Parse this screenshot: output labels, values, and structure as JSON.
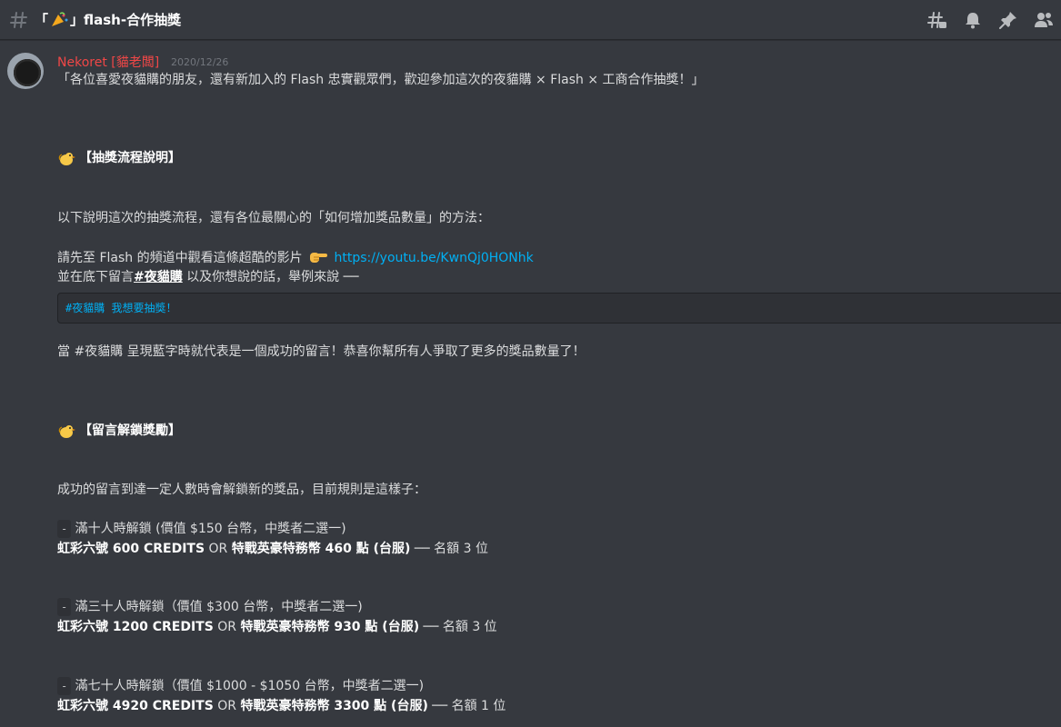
{
  "header": {
    "channel_prefix": "「",
    "channel_suffix": "」flash-合作抽獎",
    "icons": [
      "threads-icon",
      "bell-icon",
      "pin-icon",
      "members-icon"
    ]
  },
  "message": {
    "author": "Nekoret [貓老闆]",
    "timestamp": "2020/12/26",
    "intro": "「各位喜愛夜貓購的朋友，還有新加入的 Flash 忠實觀眾們，歡迎參加這次的夜貓購 × Flash × 工商合作抽獎！」",
    "section1_title": "【抽獎流程說明】",
    "section1_p1": "以下說明這次的抽獎流程，還有各位最關心的「如何增加獎品數量」的方法：",
    "section1_p2a": "請先至 Flash 的頻道中觀看這條超酷的影片",
    "section1_link": "https://youtu.be/KwnQj0HONhk",
    "section1_p3a": "並在底下留言",
    "section1_p3_tag": "#夜貓購",
    "section1_p3b": " 以及你想說的話，舉例來說 ──",
    "code_example": "#夜貓購 我想要抽獎！",
    "section1_p4": "當 #夜貓購 呈現藍字時就代表是一個成功的留言！恭喜你幫所有人爭取了更多的獎品數量了！",
    "section2_title": "【留言解鎖獎勵】",
    "section2_p1": "成功的留言到達一定人數時會解鎖新的獎品，目前規則是這樣子：",
    "tiers": [
      {
        "dash": "-",
        "title": " 滿十人時解鎖 (價值 $150 台幣，中獎者二選一)",
        "a": "虹彩六號 600 CREDITS",
        "or": " OR ",
        "b": "特戰英豪特務幣 460 點 (台服)",
        "tail": " ── 名額 3 位"
      },
      {
        "dash": "-",
        "title": " 滿三十人時解鎖（價值 $300 台幣，中獎者二選一)",
        "a": "虹彩六號 1200 CREDITS",
        "or": " OR ",
        "b": "特戰英豪特務幣 930 點 (台服)",
        "tail": " ── 名額 3 位"
      },
      {
        "dash": "-",
        "title": " 滿七十人時解鎖（價值 $1000 - $1050 台幣，中獎者二選一)",
        "a": "虹彩六號 4920 CREDITS",
        "or": " OR ",
        "b": "特戰英豪特務幣 3300 點 (台服)",
        "tail": " ── 名額 1 位"
      }
    ]
  }
}
